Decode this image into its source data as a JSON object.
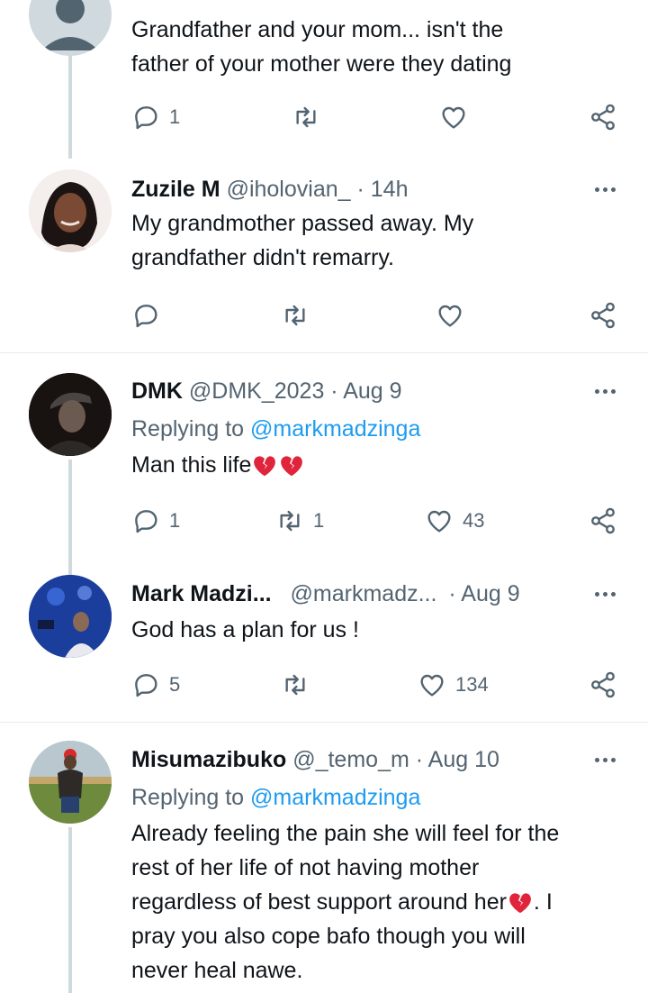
{
  "tweets": [
    {
      "body_lines": [
        "Grandfather and your mom... isn't the",
        "father of your mother were they dating"
      ],
      "actions": {
        "reply": "1",
        "retweet": "",
        "like": ""
      }
    },
    {
      "name": "Zuzile M",
      "handle": "@iholovian_",
      "time": "· 14h",
      "body_lines": [
        "My grandmother passed away. My",
        "grandfather didn't remarry."
      ],
      "actions": {
        "reply": "",
        "retweet": "",
        "like": ""
      }
    },
    {
      "name": "DMK",
      "handle": "@DMK_2023",
      "time": "· Aug 9",
      "replying_prefix": "Replying to",
      "replying_to": "@markmadzinga",
      "body_text": "Man this life",
      "actions": {
        "reply": "1",
        "retweet": "1",
        "like": "43"
      }
    },
    {
      "name": "Mark Madzi...",
      "handle": "@markmadz...",
      "time": "· Aug 9",
      "body_text": "God has a plan for us !",
      "actions": {
        "reply": "5",
        "retweet": "",
        "like": "134"
      }
    },
    {
      "name": "Misumazibuko",
      "handle": "@_temo_m",
      "time": "· Aug 10",
      "replying_prefix": "Replying to",
      "replying_to": "@markmadzinga",
      "body_lines": [
        "Already feeling the pain she will feel for the",
        "rest of her life of not having mother",
        "regardless of best support around her"
      ],
      "body_line3_suffix": ". I",
      "body_lines_after": [
        "pray you also cope bafo though you will",
        "never heal nawe."
      ]
    }
  ],
  "colors": {
    "text": "#0f1419",
    "muted": "#536471",
    "link": "#1d9bf0",
    "thread": "#cfd9de",
    "heartbreak": "#e0243b"
  },
  "icons": [
    "reply-icon",
    "retweet-icon",
    "like-icon",
    "share-icon",
    "more-icon",
    "broken-heart-emoji"
  ]
}
